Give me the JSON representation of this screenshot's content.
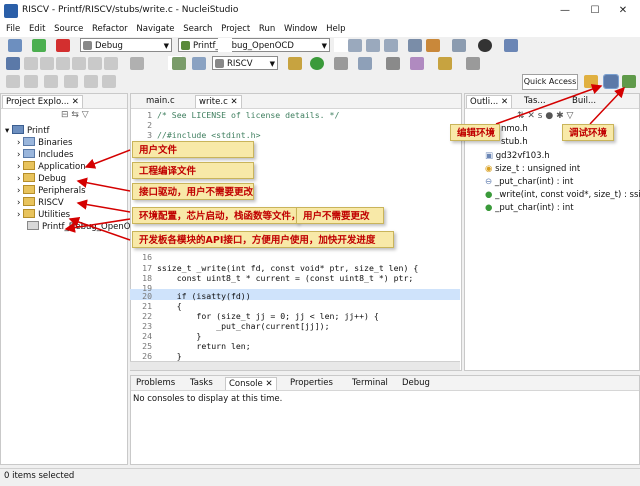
{
  "window": {
    "title": "RISCV - Printf/RISCV/stubs/write.c - NucleiStudio"
  },
  "menu": [
    "File",
    "Edit",
    "Source",
    "Refactor",
    "Navigate",
    "Search",
    "Project",
    "Run",
    "Window",
    "Help"
  ],
  "toolbar": {
    "build_config": "Debug",
    "launch_config": "Printf_Debug_OpenOCD",
    "target": "RISCV",
    "quick_access": "Quick Access"
  },
  "project_explorer": {
    "tab_label": "Project Explo...",
    "root": "Printf",
    "items": [
      "Binaries",
      "Includes",
      "Application",
      "Debug",
      "Peripherals",
      "RISCV",
      "Utilities",
      "Printf_Debug_OpenOCD"
    ]
  },
  "editor": {
    "tabs": [
      "main.c",
      "write.c"
    ],
    "lines": [
      {
        "n": "1",
        "t": "/* See LICENSE of license details. */"
      },
      {
        "n": "2",
        "t": ""
      },
      {
        "n": "3",
        "t": "//#include <stdint.h>"
      },
      {
        "n": "16",
        "t": ""
      },
      {
        "n": "17",
        "t": "ssize_t _write(int fd, const void* ptr, size_t len) {"
      },
      {
        "n": "18",
        "t": "    const uint8_t * current = (const uint8_t *) ptr;"
      },
      {
        "n": "19",
        "t": ""
      },
      {
        "n": "20",
        "t": "    if (isatty(fd))"
      },
      {
        "n": "21",
        "t": "    {"
      },
      {
        "n": "22",
        "t": "        for (size_t jj = 0; jj < len; jj++) {"
      },
      {
        "n": "23",
        "t": "            _put_char(current[jj]);"
      },
      {
        "n": "24",
        "t": "        }"
      },
      {
        "n": "25",
        "t": "        return len;"
      },
      {
        "n": "26",
        "t": "    }"
      }
    ]
  },
  "outline": {
    "tabs": [
      "Outli...",
      "Tas...",
      "Buil..."
    ],
    "items": [
      "nmo.h",
      "stub.h",
      "gd32vf103.h",
      "size_t : unsigned int",
      "_put_char(int) : int",
      "_write(int, const void*, size_t) : ssize_t",
      "_put_char(int) : int"
    ]
  },
  "console": {
    "tabs": [
      "Problems",
      "Tasks",
      "Console",
      "Properties",
      "Terminal",
      "Debug"
    ],
    "message": "No consoles to display at this time."
  },
  "status": {
    "text": "0 items selected"
  },
  "annotations": {
    "user_files": "用户文件",
    "build_files": "工程编译文件",
    "peripherals": "接口驱动，用户不需要更改",
    "riscv": "环境配置，芯片启动，栈函数等文件，",
    "riscv_extra": "用户不需要更改",
    "utilities": "开发板各模块的API接口，方便用户使用，加快开发进度",
    "edit_env": "编辑环境",
    "debug_env": "调试环境"
  },
  "colors": {
    "annotation_text": "#c00000",
    "annotation_bg": "#f8e9a8",
    "arrow": "#d40000",
    "selection": "#cfe3fb"
  }
}
